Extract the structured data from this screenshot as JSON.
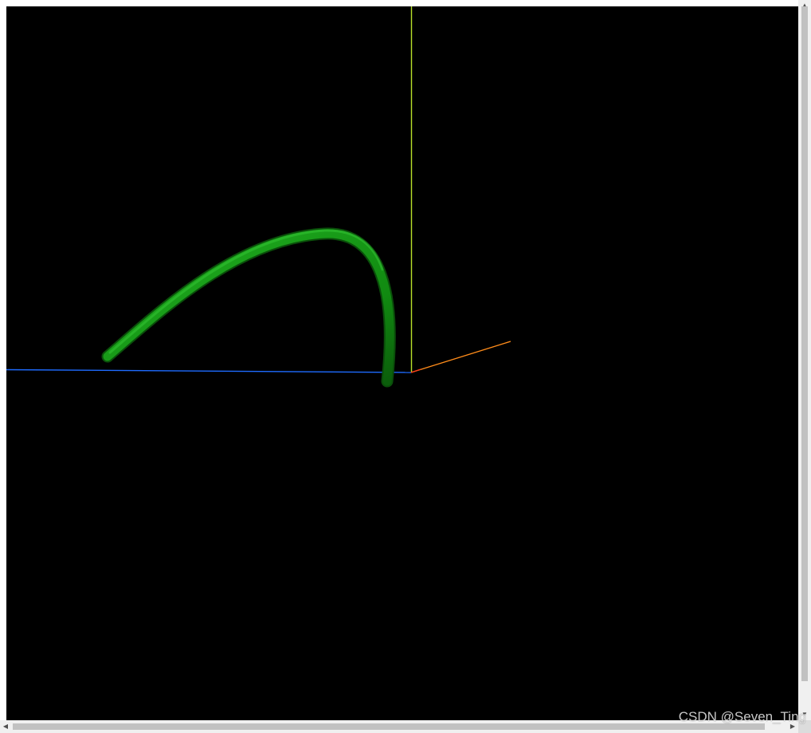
{
  "scene": {
    "background_color": "#000000",
    "axis_colors": {
      "x_axis": "#ff8c1a",
      "y_axis": "#b8e02a",
      "z_axis": "#1e6bff"
    },
    "tube_color": "#1aa51a",
    "tube_shadow_color": "#0a5a0a"
  },
  "scrollbars": {
    "vertical_up_glyph": "▲",
    "vertical_down_glyph": "▼",
    "horizontal_left_glyph": "◀",
    "horizontal_right_glyph": "▶"
  },
  "watermark": {
    "text": "CSDN @Seven_Ting"
  }
}
